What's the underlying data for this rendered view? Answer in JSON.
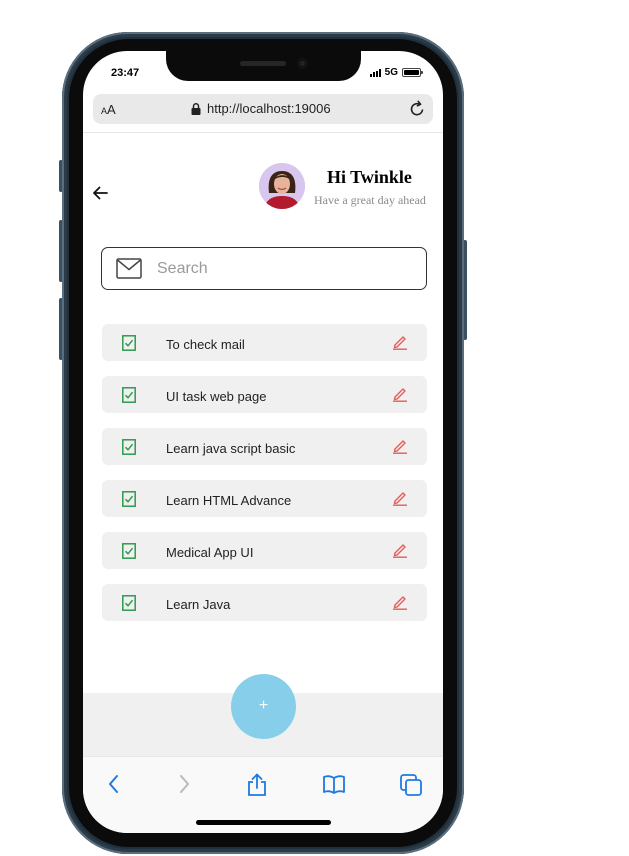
{
  "status_bar": {
    "time": "23:47",
    "network": "5G"
  },
  "browser": {
    "text_size_label": "AA",
    "url": "http://localhost:19006",
    "icons": [
      "lock-icon",
      "reload-icon",
      "back-icon",
      "forward-icon",
      "share-icon",
      "bookmarks-icon",
      "tabs-icon"
    ]
  },
  "header": {
    "greeting": "Hi Twinkle",
    "subtitle": "Have a great day ahead"
  },
  "search": {
    "placeholder": "Search",
    "value": ""
  },
  "tasks": [
    {
      "label": "To check mail"
    },
    {
      "label": "UI task web page"
    },
    {
      "label": "Learn java script basic"
    },
    {
      "label": "Learn HTML Advance"
    },
    {
      "label": "Medical App UI"
    },
    {
      "label": "Learn Java"
    }
  ],
  "fab": {
    "label": "+"
  },
  "colors": {
    "accent": "#87ceeb",
    "check": "#2e9a4f",
    "edit": "#e35d5d",
    "task_bg": "#f0f0f0",
    "avatar_bg": "#d9c6ee"
  }
}
